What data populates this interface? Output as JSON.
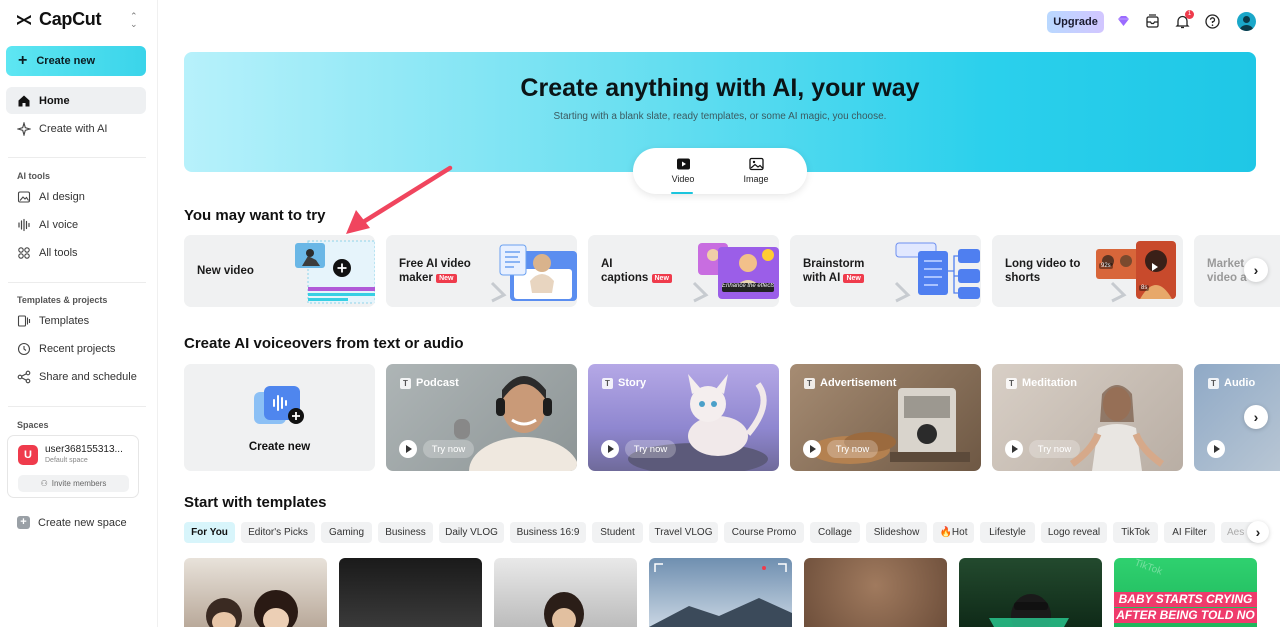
{
  "app": {
    "name": "CapCut"
  },
  "sidebar": {
    "create_new": "Create new",
    "nav": [
      {
        "label": "Home",
        "icon": "home-icon"
      },
      {
        "label": "Create with AI",
        "icon": "sparkle-icon"
      }
    ],
    "ai_tools_label": "AI tools",
    "ai_tools": [
      {
        "label": "AI design",
        "icon": "image-icon"
      },
      {
        "label": "AI voice",
        "icon": "waveform-icon"
      },
      {
        "label": "All tools",
        "icon": "grid-icon"
      }
    ],
    "templates_label": "Templates & projects",
    "templates": [
      {
        "label": "Templates",
        "icon": "template-icon"
      },
      {
        "label": "Recent projects",
        "icon": "clock-icon"
      },
      {
        "label": "Share and schedule",
        "icon": "share-icon"
      }
    ],
    "spaces_label": "Spaces",
    "space": {
      "initial": "U",
      "name": "user368155313...",
      "sub": "Default space",
      "invite": "Invite members"
    },
    "new_space": "Create new space"
  },
  "topbar": {
    "upgrade": "Upgrade",
    "notifications": "1"
  },
  "hero": {
    "title": "Create anything with AI, your way",
    "subtitle": "Starting with a blank slate, ready templates, or some AI magic, you choose.",
    "modes": [
      "Video",
      "Image"
    ],
    "selected_mode": "Video"
  },
  "try_section": {
    "title": "You may want to try",
    "new_tag": "New",
    "cards": [
      {
        "line1": "New video",
        "line2": "",
        "is_new": false
      },
      {
        "line1": "Free AI video",
        "line2": "maker",
        "is_new": true
      },
      {
        "line1": "AI",
        "line2": "captions",
        "is_new": true
      },
      {
        "line1": "Brainstorm",
        "line2": "with AI",
        "is_new": true
      },
      {
        "line1": "Long video to",
        "line2": "shorts",
        "is_new": false
      },
      {
        "line1": "Market",
        "line2": "video a",
        "is_new": false
      }
    ],
    "caption_overlay": "Enhance the effects",
    "long_video_badges": [
      "92s",
      "8s"
    ]
  },
  "voiceover_section": {
    "title": "Create AI voiceovers from text or audio",
    "create_new": "Create new",
    "try_now": "Try now",
    "cards": [
      "Podcast",
      "Story",
      "Advertisement",
      "Meditation",
      "Audio"
    ]
  },
  "templates_section": {
    "title": "Start with templates",
    "chips": [
      "For You",
      "Editor's Picks",
      "Gaming",
      "Business",
      "Daily VLOG",
      "Business 16:9",
      "Student",
      "Travel VLOG",
      "Course Promo",
      "Collage",
      "Slideshow",
      "🔥Hot",
      "Lifestyle",
      "Logo reveal",
      "TikTok",
      "AI Filter",
      "Aes"
    ],
    "active_chip": "For You",
    "thumb_text": [
      "BABY STARTS CRYING",
      "AFTER BEING TOLD NO"
    ],
    "thumb_watermark": "TikTok"
  },
  "colors": {
    "accent": "#2bd0ec",
    "new_tag": "#ef3b4c",
    "annotation_arrow": "#f0455e"
  }
}
